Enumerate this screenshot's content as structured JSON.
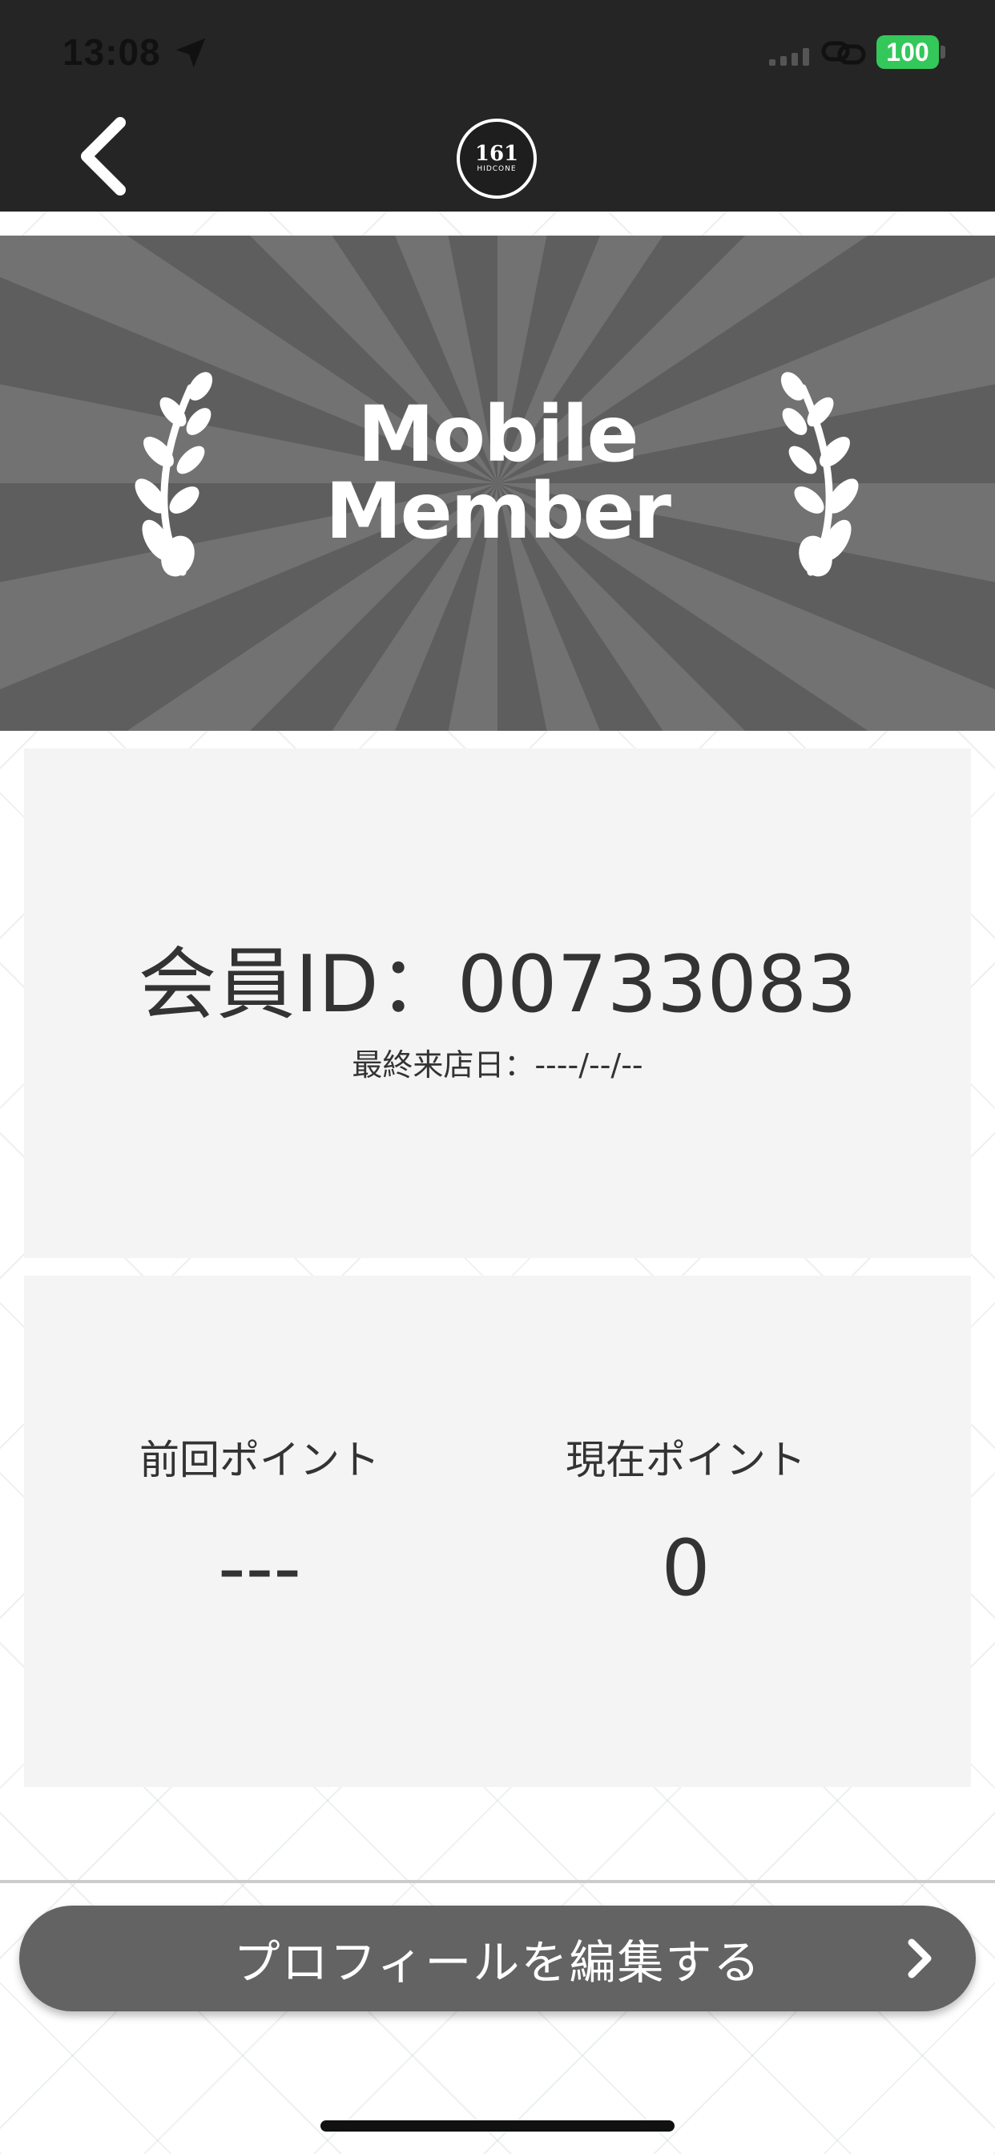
{
  "status_bar": {
    "time": "13:08",
    "battery": "100",
    "icons": [
      "location-arrow-icon",
      "signal-icon",
      "link-icon",
      "battery-icon"
    ]
  },
  "header": {
    "back_icon": "chevron-left-icon",
    "logo": {
      "number": "161",
      "subtitle": "HIDCONE"
    }
  },
  "banner": {
    "line1": "Mobile",
    "line2": "Member",
    "icons": [
      "laurel-left-icon",
      "laurel-right-icon"
    ]
  },
  "member": {
    "id_text": "会員ID：00733083",
    "last_visit": "最終来店日：----/--/--"
  },
  "points": {
    "previous_label": "前回ポイント",
    "previous_value": "---",
    "current_label": "現在ポイント",
    "current_value": "0"
  },
  "actions": {
    "edit_profile": "プロフィールを編集する",
    "edit_icon": "chevron-right-icon"
  },
  "colors": {
    "header_bg": "#252525",
    "banner_bg": "#5e5e5e",
    "card_bg": "#f4f4f4",
    "button_bg": "#636363",
    "battery": "#34c759"
  }
}
